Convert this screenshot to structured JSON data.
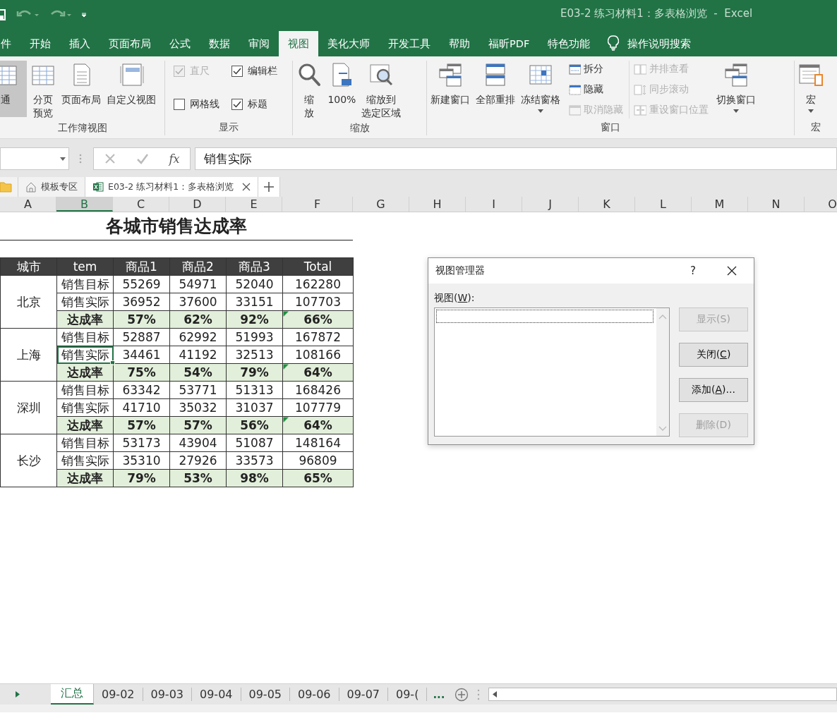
{
  "title_bar": {
    "title": "E03-2 练习材料1：多表格浏览  -  Excel"
  },
  "ribbon_tabs": [
    {
      "label": "件",
      "selected": false
    },
    {
      "label": "开始",
      "selected": false
    },
    {
      "label": "插入",
      "selected": false
    },
    {
      "label": "页面布局",
      "selected": false
    },
    {
      "label": "公式",
      "selected": false
    },
    {
      "label": "数据",
      "selected": false
    },
    {
      "label": "审阅",
      "selected": false
    },
    {
      "label": "视图",
      "selected": true
    },
    {
      "label": "美化大师",
      "selected": false
    },
    {
      "label": "开发工具",
      "selected": false
    },
    {
      "label": "帮助",
      "selected": false
    },
    {
      "label": "福昕PDF",
      "selected": false
    },
    {
      "label": "特色功能",
      "selected": false
    }
  ],
  "tell_me": {
    "label": "操作说明搜索"
  },
  "ribbon_groups": [
    {
      "label": "工作簿视图",
      "items": [
        {
          "kind": "large",
          "lines": [
            "通"
          ],
          "selected": true
        },
        {
          "kind": "large",
          "lines": [
            "分页",
            "预览"
          ],
          "selected": false
        },
        {
          "kind": "large",
          "lines": [
            "页面布局"
          ],
          "selected": false
        },
        {
          "kind": "large",
          "lines": [
            "自定义视图"
          ],
          "selected": false
        }
      ]
    },
    {
      "label": "显示",
      "items": [
        {
          "kind": "check",
          "label": "直尺",
          "checked": true,
          "disabled": true
        },
        {
          "kind": "check",
          "label": "编辑栏",
          "checked": true,
          "disabled": false
        },
        {
          "kind": "check",
          "label": "网格线",
          "checked": false,
          "disabled": false
        },
        {
          "kind": "check",
          "label": "标题",
          "checked": true,
          "disabled": false
        }
      ]
    },
    {
      "label": "缩放",
      "items": [
        {
          "kind": "large",
          "lines": [
            "缩",
            "放"
          ]
        },
        {
          "kind": "large",
          "lines": [
            "100%"
          ]
        },
        {
          "kind": "large",
          "lines": [
            "缩放到",
            "选定区域"
          ]
        }
      ]
    },
    {
      "label": "窗口",
      "items": [
        {
          "kind": "large",
          "lines": [
            "新建窗口"
          ]
        },
        {
          "kind": "large",
          "lines": [
            "全部重排"
          ]
        },
        {
          "kind": "large",
          "lines": [
            "冻结窗格"
          ],
          "dropdown": true
        },
        {
          "kind": "stack",
          "items": [
            {
              "label": "拆分",
              "disabled": false
            },
            {
              "label": "隐藏",
              "disabled": false
            },
            {
              "label": "取消隐藏",
              "disabled": true
            }
          ]
        },
        {
          "kind": "stack",
          "items": [
            {
              "label": "并排查看",
              "disabled": true
            },
            {
              "label": "同步滚动",
              "disabled": true
            },
            {
              "label": "重设窗口位置",
              "disabled": true
            }
          ]
        },
        {
          "kind": "large",
          "lines": [
            "切换窗口"
          ],
          "dropdown": true
        }
      ]
    },
    {
      "label": "宏",
      "items": [
        {
          "kind": "large",
          "lines": [
            "宏"
          ],
          "dropdown": true
        }
      ]
    }
  ],
  "formula_bar": {
    "fx": "fx",
    "value": "销售实际"
  },
  "workbook_tabs": [
    {
      "kind": "folder"
    },
    {
      "kind": "home",
      "label": "模板专区",
      "selected": false
    },
    {
      "kind": "excel",
      "label": "E03-2 练习材料1：多表格浏览",
      "selected": true
    }
  ],
  "columns": [
    {
      "label": "A",
      "selected": false
    },
    {
      "label": "B",
      "selected": true
    },
    {
      "label": "C",
      "selected": false
    },
    {
      "label": "D",
      "selected": false
    },
    {
      "label": "E",
      "selected": false
    },
    {
      "label": "F",
      "selected": false
    },
    {
      "label": "G",
      "selected": false
    },
    {
      "label": "H",
      "selected": false
    },
    {
      "label": "I",
      "selected": false
    },
    {
      "label": "J",
      "selected": false
    },
    {
      "label": "K",
      "selected": false
    },
    {
      "label": "L",
      "selected": false
    },
    {
      "label": "M",
      "selected": false
    },
    {
      "label": "N",
      "selected": false
    },
    {
      "label": "O",
      "selected": false
    }
  ],
  "sheet": {
    "title": "各城市销售达成率",
    "header": [
      "城市",
      "tem",
      "商品1",
      "商品2",
      "商品3",
      "Total"
    ],
    "groups": [
      {
        "city": "北京",
        "rows": [
          {
            "kind": "plain",
            "cells": [
              "销售目标",
              "55269",
              "54971",
              "52040",
              "162280"
            ],
            "selected": false,
            "flagged": false
          },
          {
            "kind": "plain",
            "cells": [
              "销售实际",
              "36952",
              "37600",
              "33151",
              "107703"
            ],
            "selected": false,
            "flagged": false
          },
          {
            "kind": "rate",
            "cells": [
              "达成率",
              "57%",
              "62%",
              "92%",
              "66%"
            ],
            "selected": false,
            "flagged": true
          }
        ]
      },
      {
        "city": "上海",
        "rows": [
          {
            "kind": "plain",
            "cells": [
              "销售目标",
              "52887",
              "62992",
              "51993",
              "167872"
            ],
            "selected": false,
            "flagged": false
          },
          {
            "kind": "plain",
            "cells": [
              "销售实际",
              "34461",
              "41192",
              "32513",
              "108166"
            ],
            "selected": true,
            "flagged": false
          },
          {
            "kind": "rate",
            "cells": [
              "达成率",
              "75%",
              "54%",
              "79%",
              "64%"
            ],
            "selected": false,
            "flagged": true
          }
        ]
      },
      {
        "city": "深圳",
        "rows": [
          {
            "kind": "plain",
            "cells": [
              "销售目标",
              "63342",
              "53771",
              "51313",
              "168426"
            ],
            "selected": false,
            "flagged": false
          },
          {
            "kind": "plain",
            "cells": [
              "销售实际",
              "41710",
              "35032",
              "31037",
              "107779"
            ],
            "selected": false,
            "flagged": false
          },
          {
            "kind": "rate",
            "cells": [
              "达成率",
              "57%",
              "57%",
              "56%",
              "64%"
            ],
            "selected": false,
            "flagged": true
          }
        ]
      },
      {
        "city": "长沙",
        "rows": [
          {
            "kind": "plain",
            "cells": [
              "销售目标",
              "53173",
              "43904",
              "51087",
              "148164"
            ],
            "selected": false,
            "flagged": false
          },
          {
            "kind": "plain",
            "cells": [
              "销售实际",
              "35310",
              "27926",
              "33573",
              "96809"
            ],
            "selected": false,
            "flagged": false
          },
          {
            "kind": "rate",
            "cells": [
              "达成率",
              "79%",
              "53%",
              "98%",
              "65%"
            ],
            "selected": false,
            "flagged": false
          }
        ]
      }
    ]
  },
  "dialog": {
    "title": "视图管理器",
    "help": "?",
    "list_label": [
      "视图(",
      "W",
      "):"
    ],
    "buttons": [
      {
        "parts": [
          "显示(S)"
        ],
        "disabled": true
      },
      {
        "parts": [
          "关闭(",
          "C",
          ")"
        ],
        "disabled": false
      },
      {
        "parts": [
          "添加(",
          "A",
          ")..."
        ],
        "disabled": false
      },
      {
        "parts": [
          "删除(D)"
        ],
        "disabled": true
      }
    ]
  },
  "sheet_tabs": [
    {
      "label": "汇总",
      "selected": true
    },
    {
      "label": "09-02",
      "selected": false
    },
    {
      "label": "09-03",
      "selected": false
    },
    {
      "label": "09-04",
      "selected": false
    },
    {
      "label": "09-05",
      "selected": false
    },
    {
      "label": "09-06",
      "selected": false
    },
    {
      "label": "09-07",
      "selected": false
    },
    {
      "label": "09-(",
      "selected": false
    }
  ],
  "sheet_tabs_more": "..."
}
